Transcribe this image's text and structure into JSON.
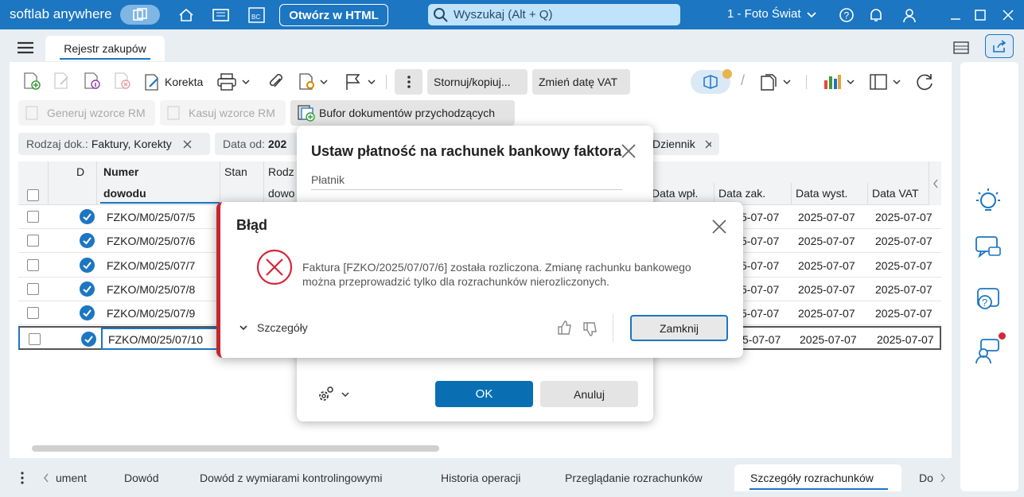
{
  "app": {
    "brand": "softlab anywhere",
    "open_html": "Otwórz w HTML",
    "search_placeholder": "Wyszukaj (Alt + Q)",
    "company": "1 - Foto Świat"
  },
  "tab": {
    "title": "Rejestr zakupów"
  },
  "toolbar": {
    "korekta": "Korekta",
    "stornuj": "Stornuj/kopiuj...",
    "zmien_date": "Zmień datę VAT",
    "generuj": "Generuj wzorce RM",
    "kasuj": "Kasuj wzorce RM",
    "bufor": "Bufor dokumentów przychodzących"
  },
  "filters": [
    {
      "label": "Rodzaj dok.:",
      "value": "Faktury, Korekty"
    },
    {
      "label": "Data  od:",
      "value": "202"
    },
    {
      "label": "",
      "value": "Dziennik"
    }
  ],
  "table": {
    "headers": {
      "d": "D",
      "numer1": "Numer",
      "numer2": "dowodu",
      "stan": "Stan",
      "rodz1": "Rodz",
      "rodz2": "dowo",
      "data_wpl": "Data wpł.",
      "data_zak": "Data zak.",
      "data_wyst": "Data wyst.",
      "data_vat": "Data VAT"
    },
    "rows": [
      {
        "numer": "FZKO/M0/25/07/5",
        "zak": "5-07-07",
        "wyst": "2025-07-07",
        "vat": "2025-07-07"
      },
      {
        "numer": "FZKO/M0/25/07/6",
        "zak": "5-07-07",
        "wyst": "2025-07-07",
        "vat": "2025-07-07"
      },
      {
        "numer": "FZKO/M0/25/07/7",
        "zak": "5-07-07",
        "wyst": "2025-07-07",
        "vat": "2025-07-07"
      },
      {
        "numer": "FZKO/M0/25/07/8",
        "zak": "5-07-07",
        "wyst": "2025-07-07",
        "vat": "2025-07-07"
      },
      {
        "numer": "FZKO/M0/25/07/9",
        "zak": "5-07-07",
        "wyst": "2025-07-07",
        "vat": "2025-07-07"
      },
      {
        "numer": "FZKO/M0/25/07/10",
        "zak": "5-07-07",
        "wyst": "2025-07-07",
        "vat": "2025-07-07"
      }
    ]
  },
  "bottom_tabs": [
    "ument",
    "Dowód",
    "Dowód z wymiarami kontrolingowymi",
    "Historia operacji",
    "Przeglądanie rozrachunków",
    "Szczegóły rozrachunków",
    "Do"
  ],
  "dialog_payment": {
    "title": "Ustaw płatność na rachunek bankowy faktora",
    "field_label": "Płatnik",
    "ok": "OK",
    "cancel": "Anuluj"
  },
  "dialog_error": {
    "title": "Błąd",
    "message_line1": "Faktura [FZKO/2025/07/07/6] została rozliczona. Zmianę rachunku bankowego",
    "message_line2": "można przeprowadzić tylko dla rozrachunków nierozliczonych.",
    "details": "Szczegóły",
    "close": "Zamknij"
  },
  "colors": {
    "brand": "#1c76c2",
    "error": "#c4262e",
    "primary": "#0a6fb2"
  }
}
